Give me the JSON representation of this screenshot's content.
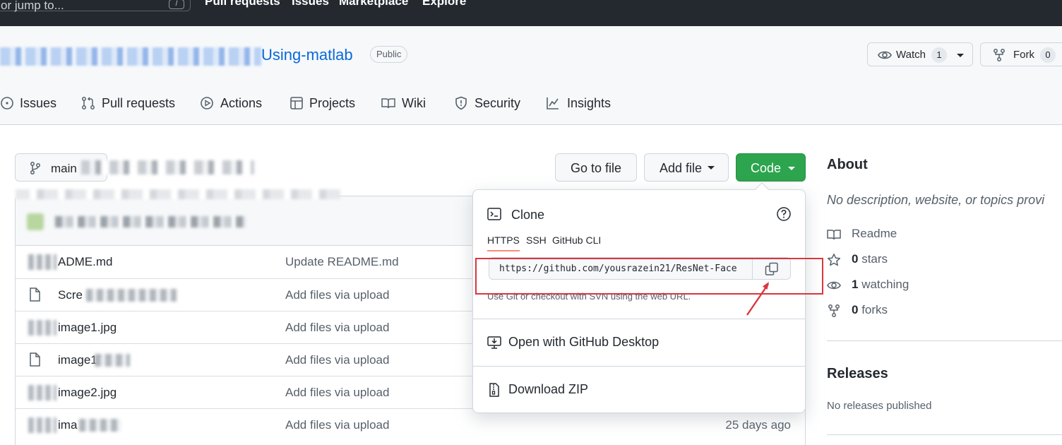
{
  "header": {
    "search_placeholder": "or jump to...",
    "search_shortcut": "/",
    "nav": [
      "Pull requests",
      "Issues",
      "Marketplace",
      "Explore"
    ]
  },
  "repo": {
    "name_visible": "Using-matlab",
    "visibility": "Public",
    "watch_label": "Watch",
    "watch_count": "1",
    "fork_label": "Fork",
    "fork_count": "0"
  },
  "tabs": [
    {
      "label": "Issues",
      "icon": "issue-opened-icon"
    },
    {
      "label": "Pull requests",
      "icon": "git-pull-request-icon"
    },
    {
      "label": "Actions",
      "icon": "play-icon"
    },
    {
      "label": "Projects",
      "icon": "table-icon"
    },
    {
      "label": "Wiki",
      "icon": "book-icon"
    },
    {
      "label": "Security",
      "icon": "shield-icon"
    },
    {
      "label": "Insights",
      "icon": "graph-icon"
    }
  ],
  "toolbar": {
    "branch": "main",
    "go_to_file": "Go to file",
    "add_file": "Add file",
    "code": "Code"
  },
  "files": [
    {
      "name": "ADME.md",
      "message": "Update README.md",
      "time": "",
      "icon": "file-icon"
    },
    {
      "name": "Scre",
      "message": "Add files via upload",
      "time": "",
      "icon": "file-icon"
    },
    {
      "name": "image1.jpg",
      "message": "Add files via upload",
      "time": "",
      "icon": "file-media-icon"
    },
    {
      "name": "image10",
      "message": "Add files via upload",
      "time": "",
      "icon": "file-icon"
    },
    {
      "name": "image2.jpg",
      "message": "Add files via upload",
      "time": "",
      "icon": "file-media-icon"
    },
    {
      "name": "ima",
      "message": "Add files via upload",
      "time": "25 days ago",
      "icon": "file-media-icon"
    }
  ],
  "clone": {
    "title": "Clone",
    "tabs": [
      "HTTPS",
      "SSH",
      "GitHub CLI"
    ],
    "url": "https://github.com/yousrazein21/ResNet-Face",
    "hint": "Use Git or checkout with SVN using the web URL.",
    "open_desktop": "Open with GitHub Desktop",
    "download_zip": "Download ZIP"
  },
  "about": {
    "heading": "About",
    "description": "No description, website, or topics provi",
    "readme": "Readme",
    "stars_count": "0",
    "stars_label": "stars",
    "watching_count": "1",
    "watching_label": "watching",
    "forks_count": "0",
    "forks_label": "forks"
  },
  "releases": {
    "heading": "Releases",
    "text": "No releases published"
  },
  "colors": {
    "header_bg": "#24292f",
    "link_blue": "#0969da",
    "code_green": "#2da44e",
    "annotation_red": "#d9363e",
    "tab_underline": "#fd8c73"
  }
}
